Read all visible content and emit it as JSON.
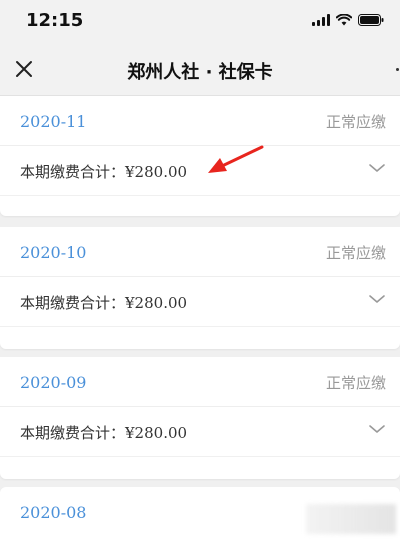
{
  "status_bar": {
    "time": "12:15"
  },
  "nav": {
    "title": "郑州人社 · 社保卡"
  },
  "records": [
    {
      "month": "2020-11",
      "status": "正常应缴",
      "total_label": "本期缴费合计：",
      "total_amount": "¥280.00"
    },
    {
      "month": "2020-10",
      "status": "正常应缴",
      "total_label": "本期缴费合计：",
      "total_amount": "¥280.00"
    },
    {
      "month": "2020-09",
      "status": "正常应缴",
      "total_label": "本期缴费合计：",
      "total_amount": "¥280.00"
    },
    {
      "month": "2020-08"
    }
  ],
  "colors": {
    "accent": "#4a90d9",
    "annotation_arrow": "#e8251e",
    "status_text": "#999999"
  },
  "icons": [
    "close-icon",
    "more-icon",
    "chevron-down-icon",
    "signal-icon",
    "wifi-icon",
    "battery-icon",
    "annotation-arrow"
  ]
}
